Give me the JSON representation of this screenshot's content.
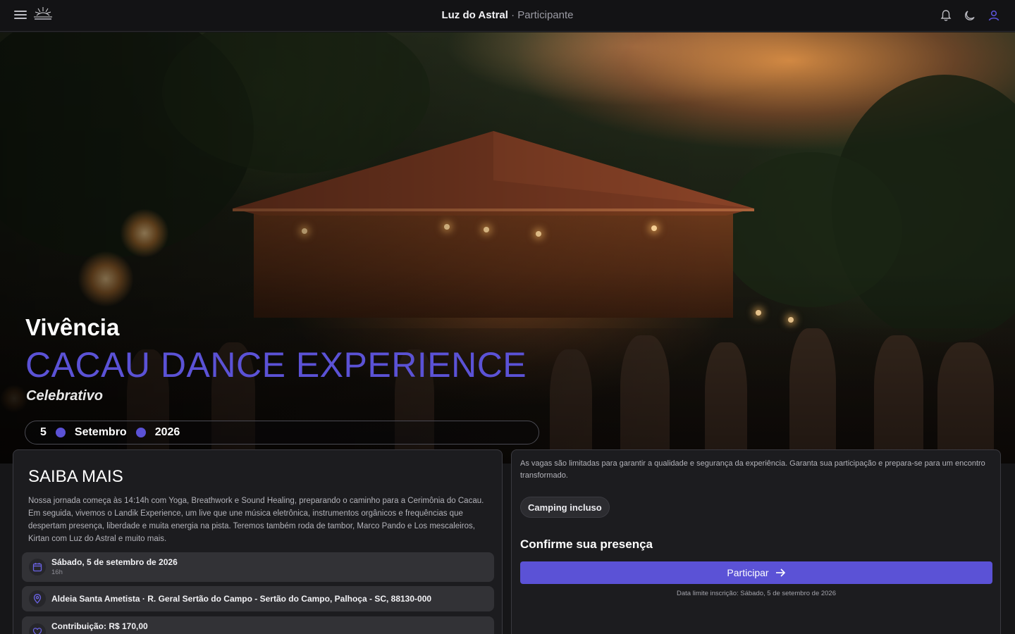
{
  "header": {
    "app_name": "Luz do Astral",
    "separator": "·",
    "role": "Participante",
    "icons": [
      "menu-icon",
      "logo",
      "bell-icon",
      "moon-icon",
      "user-icon"
    ]
  },
  "hero": {
    "kicker": "Vivência",
    "title": "CACAU DANCE EXPERIENCE",
    "subtitle": "Celebrativo",
    "date": {
      "day": "5",
      "month": "Setembro",
      "year": "2026"
    }
  },
  "about": {
    "heading": "SAIBA MAIS",
    "description": "Nossa jornada começa às 14:14h com Yoga, Breathwork e Sound Healing, preparando o caminho para a Cerimônia do Cacau. Em seguida, vivemos o Landik Experience, um live que une música eletrônica, instrumentos orgânicos e frequências que despertam presença, liberdade e muita energia na pista. Teremos também roda de tambor, Marco Pando e Los mescaleiros, Kirtan com Luz do Astral e muito mais.",
    "date_row": {
      "label": "Sábado, 5 de setembro de 2026",
      "time": "16h"
    },
    "location": "Aldeia Santa Ametista · R. Geral Sertão do Campo - Sertão do Campo, Palhoça - SC, 88130-000",
    "contribution": "Contribuição: R$ 170,00"
  },
  "booking": {
    "notice": "As vagas são limitadas para garantir a qualidade e segurança da experiência. Garanta sua participação e prepara-se para um encontro transformado.",
    "badge": "Camping incluso",
    "confirm_heading": "Confirme sua presença",
    "cta_label": "Participar",
    "deadline": "Data limite inscrição: Sábado, 5 de setembro de 2026"
  },
  "colors": {
    "accent": "#5b52d6",
    "background": "#161618",
    "card": "#1c1c1f"
  }
}
